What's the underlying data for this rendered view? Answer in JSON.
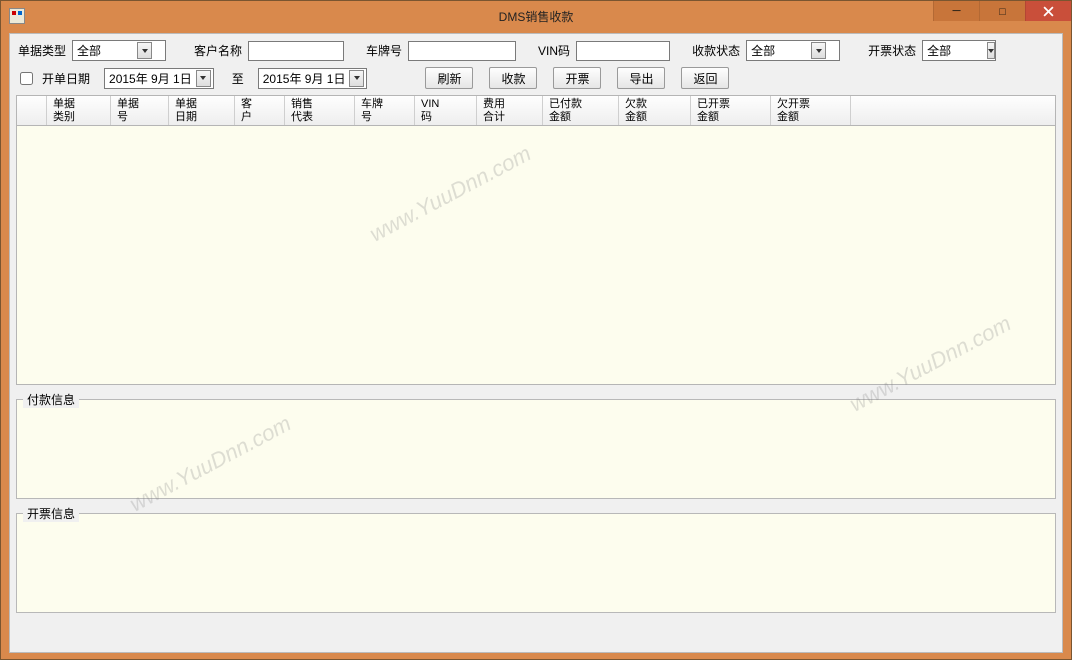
{
  "window": {
    "title": "DMS销售收款"
  },
  "filters": {
    "doc_type_label": "单据类型",
    "doc_type_value": "全部",
    "customer_label": "客户名称",
    "customer_value": "",
    "plate_label": "车牌号",
    "plate_value": "",
    "vin_label": "VIN码",
    "vin_value": "",
    "pay_status_label": "收款状态",
    "pay_status_value": "全部",
    "invoice_status_label": "开票状态",
    "invoice_status_value": "全部",
    "date_checkbox_label": "开单日期",
    "date_from": "2015年 9月 1日",
    "date_to_label": "至",
    "date_to": "2015年 9月 1日"
  },
  "buttons": {
    "refresh": "刷新",
    "collect": "收款",
    "invoice": "开票",
    "export": "导出",
    "back": "返回"
  },
  "grid": {
    "columns": [
      "单据\n类别",
      "单据\n号",
      "单据\n日期",
      "客\n户",
      "销售\n代表",
      "车牌\n号",
      "VIN\n码",
      "费用\n合计",
      "已付款\n金额",
      "欠款\n金额",
      "已开票\n金额",
      "欠开票\n金额"
    ]
  },
  "panels": {
    "payment_info": "付款信息",
    "invoice_info": "开票信息"
  },
  "watermark": "www.YuuDnn.com"
}
